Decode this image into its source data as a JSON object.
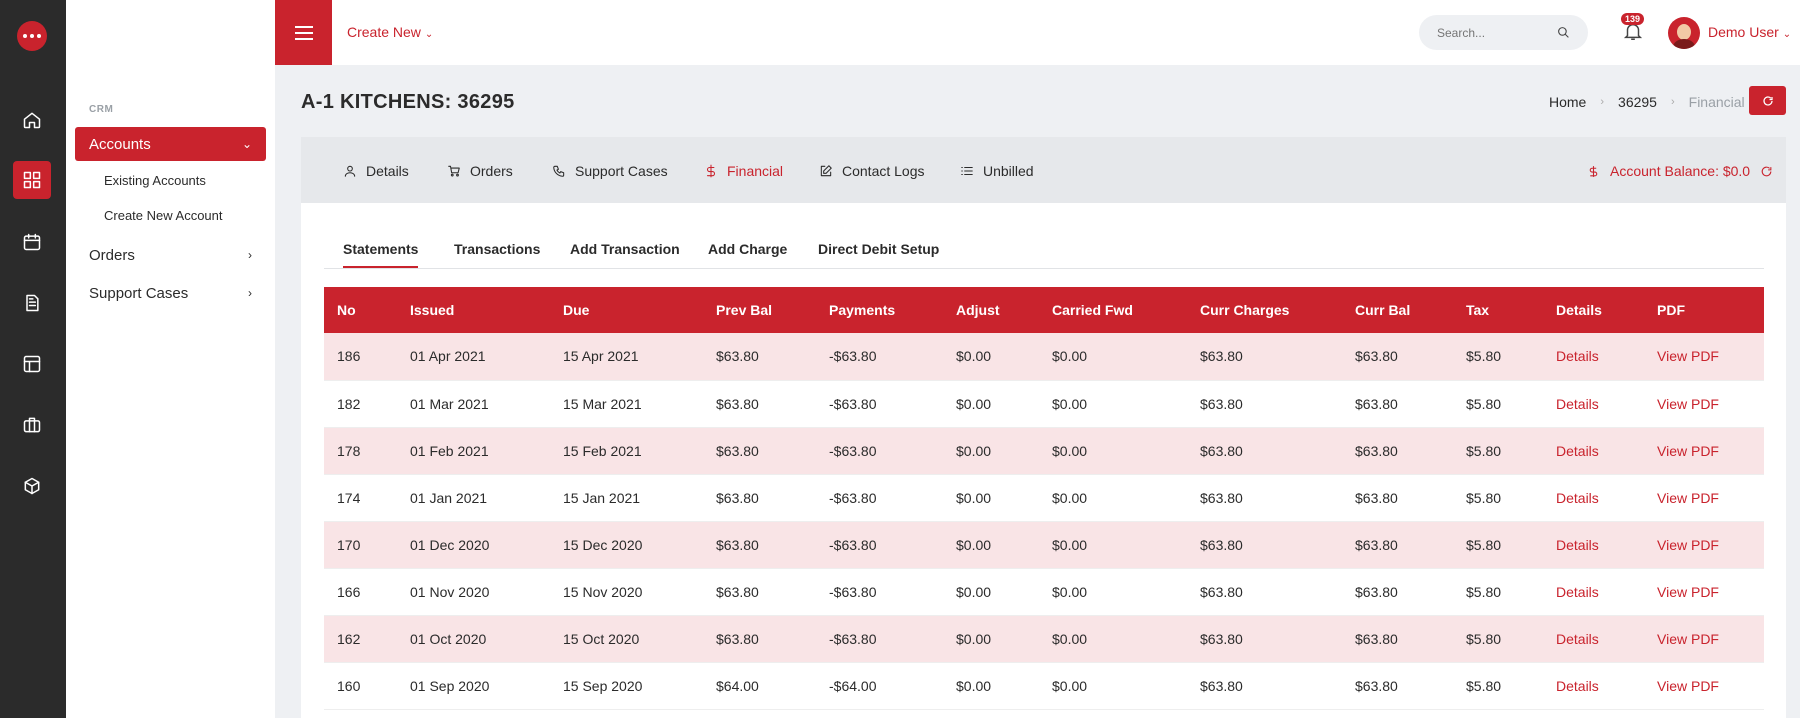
{
  "topbar": {
    "create_new": "Create New",
    "search_placeholder": "Search...",
    "notification_count": "139",
    "user_name": "Demo User"
  },
  "rail": {
    "items": [
      "home-icon",
      "dashboard-icon",
      "calendar-icon",
      "document-icon",
      "layout-icon",
      "briefcase-icon",
      "package-icon"
    ]
  },
  "sidebar": {
    "section": "CRM",
    "accounts": "Accounts",
    "existing_accounts": "Existing Accounts",
    "create_new_account": "Create New Account",
    "orders": "Orders",
    "support_cases": "Support Cases"
  },
  "page": {
    "title": "A-1 KITCHENS: 36295",
    "breadcrumb": [
      "Home",
      "36295",
      "Financial"
    ]
  },
  "tabs": {
    "details": "Details",
    "orders": "Orders",
    "support_cases": "Support Cases",
    "financial": "Financial",
    "contact_logs": "Contact Logs",
    "unbilled": "Unbilled",
    "balance": "Account Balance: $0.0"
  },
  "subtabs": {
    "statements": "Statements",
    "transactions": "Transactions",
    "add_transaction": "Add Transaction",
    "add_charge": "Add Charge",
    "direct_debit": "Direct Debit Setup"
  },
  "table": {
    "headers": [
      "No",
      "Issued",
      "Due",
      "Prev Bal",
      "Payments",
      "Adjust",
      "Carried Fwd",
      "Curr Charges",
      "Curr Bal",
      "Tax",
      "Details",
      "PDF"
    ],
    "rows": [
      [
        "186",
        "01 Apr 2021",
        "15 Apr 2021",
        "$63.80",
        "-$63.80",
        "$0.00",
        "$0.00",
        "$63.80",
        "$63.80",
        "$5.80",
        "Details",
        "View PDF"
      ],
      [
        "182",
        "01 Mar 2021",
        "15 Mar 2021",
        "$63.80",
        "-$63.80",
        "$0.00",
        "$0.00",
        "$63.80",
        "$63.80",
        "$5.80",
        "Details",
        "View PDF"
      ],
      [
        "178",
        "01 Feb 2021",
        "15 Feb 2021",
        "$63.80",
        "-$63.80",
        "$0.00",
        "$0.00",
        "$63.80",
        "$63.80",
        "$5.80",
        "Details",
        "View PDF"
      ],
      [
        "174",
        "01 Jan 2021",
        "15 Jan 2021",
        "$63.80",
        "-$63.80",
        "$0.00",
        "$0.00",
        "$63.80",
        "$63.80",
        "$5.80",
        "Details",
        "View PDF"
      ],
      [
        "170",
        "01 Dec 2020",
        "15 Dec 2020",
        "$63.80",
        "-$63.80",
        "$0.00",
        "$0.00",
        "$63.80",
        "$63.80",
        "$5.80",
        "Details",
        "View PDF"
      ],
      [
        "166",
        "01 Nov 2020",
        "15 Nov 2020",
        "$63.80",
        "-$63.80",
        "$0.00",
        "$0.00",
        "$63.80",
        "$63.80",
        "$5.80",
        "Details",
        "View PDF"
      ],
      [
        "162",
        "01 Oct 2020",
        "15 Oct 2020",
        "$63.80",
        "-$63.80",
        "$0.00",
        "$0.00",
        "$63.80",
        "$63.80",
        "$5.80",
        "Details",
        "View PDF"
      ],
      [
        "160",
        "01 Sep 2020",
        "15 Sep 2020",
        "$64.00",
        "-$64.00",
        "$0.00",
        "$0.00",
        "$63.80",
        "$63.80",
        "$5.80",
        "Details",
        "View PDF"
      ]
    ]
  },
  "colors": {
    "accent": "#c9232d",
    "rail_bg": "#2b2b2b",
    "row_tint": "#f9e4e6"
  }
}
